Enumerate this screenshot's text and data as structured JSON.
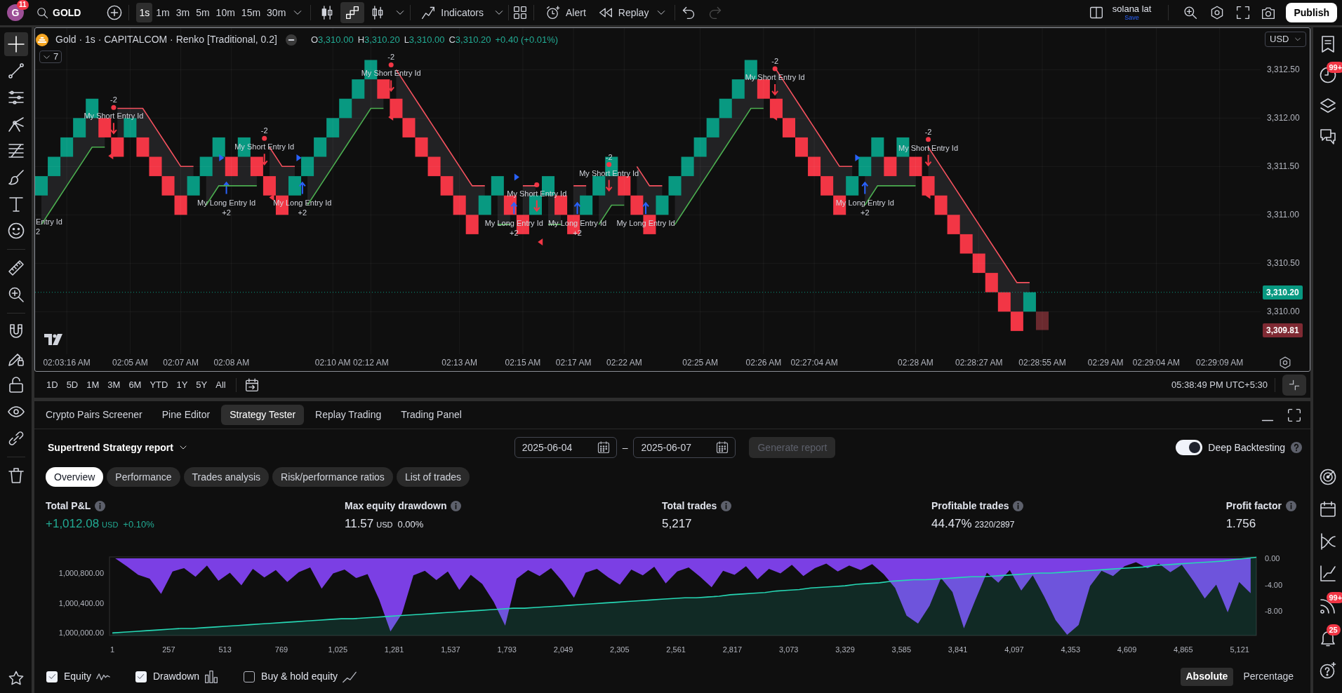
{
  "header": {
    "avatar": {
      "letter": "G",
      "badge": "11"
    },
    "symbol": "GOLD",
    "timeframes": [
      {
        "label": "1s",
        "selected": true
      },
      {
        "label": "1m",
        "selected": false
      },
      {
        "label": "3m",
        "selected": false
      },
      {
        "label": "5m",
        "selected": false
      },
      {
        "label": "10m",
        "selected": false
      },
      {
        "label": "15m",
        "selected": false
      },
      {
        "label": "30m",
        "selected": false
      }
    ],
    "chart_types": [
      {
        "kind": "candles",
        "selected": false
      },
      {
        "kind": "renko",
        "selected": true
      },
      {
        "kind": "hollow",
        "selected": false
      }
    ],
    "indicators": "Indicators",
    "alert": "Alert",
    "replay": "Replay",
    "undo": {
      "disabled": false
    },
    "redo": {
      "disabled": true
    },
    "layout": {
      "name": "solana lat",
      "status": "Save"
    },
    "publish": "Publish"
  },
  "left_toolbar": {
    "groups": [
      {
        "tools": [
          {
            "kind": "crosshair",
            "selected": true
          },
          {
            "kind": "trend_line",
            "selected": false
          },
          {
            "kind": "hlines",
            "selected": false
          },
          {
            "kind": "pitchfork",
            "selected": false
          },
          {
            "kind": "fib",
            "selected": false
          },
          {
            "kind": "brush",
            "selected": false
          },
          {
            "kind": "text",
            "selected": false
          },
          {
            "kind": "emoji",
            "selected": false
          }
        ]
      },
      {
        "tools": [
          {
            "kind": "ruler",
            "selected": false
          },
          {
            "kind": "zoom_in",
            "selected": false
          }
        ]
      },
      {
        "tools": [
          {
            "kind": "magnet",
            "selected": false
          },
          {
            "kind": "lock_draw",
            "selected": false
          },
          {
            "kind": "lock",
            "selected": false
          },
          {
            "kind": "eye",
            "selected": false
          },
          {
            "kind": "link",
            "selected": false
          }
        ]
      },
      {
        "tools": [
          {
            "kind": "trash",
            "selected": false
          }
        ]
      }
    ]
  },
  "chart": {
    "ohlc": [
      {
        "key": "O",
        "value": "3,310.00"
      },
      {
        "key": "H",
        "value": "3,310.20"
      },
      {
        "key": "L",
        "value": "3,310.00"
      },
      {
        "key": "C",
        "value": "3,310.20"
      }
    ],
    "change": "+0.40 (+0.01%)",
    "indicators_count": "7",
    "currency": "USD",
    "bricks": [
      {
        "kind": "up"
      },
      {
        "kind": "up"
      },
      {
        "kind": "up"
      },
      {
        "kind": "up"
      },
      {
        "kind": "up"
      },
      {
        "kind": "down"
      },
      {
        "kind": "down"
      },
      {
        "kind": "up"
      },
      {
        "kind": "down"
      },
      {
        "kind": "down"
      },
      {
        "kind": "down"
      },
      {
        "kind": "down"
      },
      {
        "kind": "up"
      },
      {
        "kind": "up"
      },
      {
        "kind": "up"
      },
      {
        "kind": "down"
      },
      {
        "kind": "up"
      },
      {
        "kind": "down"
      },
      {
        "kind": "down"
      },
      {
        "kind": "down"
      },
      {
        "kind": "up"
      },
      {
        "kind": "up"
      },
      {
        "kind": "up"
      },
      {
        "kind": "up"
      },
      {
        "kind": "up"
      },
      {
        "kind": "up"
      },
      {
        "kind": "up"
      },
      {
        "kind": "down"
      },
      {
        "kind": "down"
      },
      {
        "kind": "down"
      },
      {
        "kind": "down"
      },
      {
        "kind": "down"
      },
      {
        "kind": "down"
      },
      {
        "kind": "down"
      },
      {
        "kind": "down"
      },
      {
        "kind": "up"
      },
      {
        "kind": "up"
      },
      {
        "kind": "down"
      },
      {
        "kind": "down"
      },
      {
        "kind": "up"
      },
      {
        "kind": "up"
      },
      {
        "kind": "down"
      },
      {
        "kind": "down"
      },
      {
        "kind": "up"
      },
      {
        "kind": "up"
      },
      {
        "kind": "up"
      },
      {
        "kind": "down"
      },
      {
        "kind": "down"
      },
      {
        "kind": "down"
      },
      {
        "kind": "up"
      },
      {
        "kind": "up"
      },
      {
        "kind": "up"
      },
      {
        "kind": "up"
      },
      {
        "kind": "up"
      },
      {
        "kind": "up"
      },
      {
        "kind": "up"
      },
      {
        "kind": "up"
      },
      {
        "kind": "down"
      },
      {
        "kind": "down"
      },
      {
        "kind": "down"
      },
      {
        "kind": "down"
      },
      {
        "kind": "down"
      },
      {
        "kind": "down"
      },
      {
        "kind": "down"
      },
      {
        "kind": "up"
      },
      {
        "kind": "up"
      },
      {
        "kind": "up"
      },
      {
        "kind": "down"
      },
      {
        "kind": "up"
      },
      {
        "kind": "down"
      },
      {
        "kind": "down"
      },
      {
        "kind": "down"
      },
      {
        "kind": "down"
      },
      {
        "kind": "down"
      },
      {
        "kind": "down"
      },
      {
        "kind": "down"
      },
      {
        "kind": "down"
      },
      {
        "kind": "down"
      },
      {
        "kind": "up"
      },
      {
        "kind": "pending"
      }
    ],
    "signals": [
      {
        "kind": "long",
        "label": "Entry Id",
        "qty": "2"
      },
      {
        "kind": "short",
        "label": "My Short Entry Id",
        "qty": "-2"
      },
      {
        "kind": "long",
        "label": "My Long Entry Id",
        "qty": "+2"
      },
      {
        "kind": "short",
        "label": "My Short Entry Id",
        "qty": "-2"
      },
      {
        "kind": "long",
        "label": "My Long Entry Id",
        "qty": "+2"
      },
      {
        "kind": "short",
        "label": "My Short Entry Id",
        "qty": "-2"
      },
      {
        "kind": "long",
        "label": "My Long Entry Id",
        "qty": "+2"
      },
      {
        "kind": "short",
        "label": "My Short Entry Id"
      },
      {
        "kind": "long",
        "label": "My Long Entry Id",
        "qty": "+2"
      },
      {
        "kind": "short",
        "label": "My Short Entry Id",
        "qty": "-2"
      },
      {
        "kind": "long",
        "label": "My Long Entry Id"
      },
      {
        "kind": "short",
        "label": "My Short Entry Id",
        "qty": "-2"
      },
      {
        "kind": "long",
        "label": "My Long Entry Id",
        "qty": "+2"
      },
      {
        "kind": "short",
        "label": "My Short Entry Id",
        "qty": "-2"
      }
    ],
    "markers": [
      {
        "kind": "short"
      },
      {
        "kind": "long"
      },
      {
        "kind": "short"
      },
      {
        "kind": "long"
      },
      {
        "kind": "short"
      },
      {
        "kind": "long"
      },
      {
        "kind": "short"
      },
      {
        "kind": "short"
      },
      {
        "kind": "long"
      },
      {
        "kind": "short"
      }
    ],
    "price_tags": [
      {
        "label": "3,310.20",
        "color": "#089981"
      },
      {
        "label": "3,309.81",
        "color": "#7f2a33"
      }
    ],
    "chart_data": {
      "type": "line",
      "title": "Gold · 1s · CAPITALCOM · Renko [Traditional, 0.2]",
      "categories": [
        null,
        null,
        "02:03:16 AM",
        null,
        null,
        null,
        null,
        "02:05 AM",
        null,
        null,
        null,
        "02:07 AM",
        null,
        null,
        null,
        "02:08 AM",
        null,
        null,
        null,
        null,
        null,
        null,
        null,
        "02:10 AM",
        null,
        null,
        "02:12 AM",
        null,
        null,
        null,
        null,
        null,
        null,
        "02:13 AM",
        null,
        null,
        null,
        null,
        "02:15 AM",
        null,
        null,
        null,
        "02:17 AM",
        null,
        null,
        null,
        "02:22 AM",
        null,
        null,
        null,
        null,
        null,
        "02:25 AM",
        null,
        null,
        null,
        null,
        "02:26 AM",
        null,
        null,
        null,
        "02:27:04 AM",
        null,
        null,
        null,
        null,
        null,
        null,
        null,
        "02:28 AM",
        null,
        null,
        null,
        null,
        "02:28:27 AM",
        null,
        null,
        null,
        null,
        "02:28:55 AM",
        null,
        null,
        null,
        null,
        "02:29 AM",
        null,
        null,
        null,
        "02:29:04 AM",
        null,
        null,
        null,
        null,
        "02:29:09 AM"
      ],
      "series": [
        {
          "color": "#4caf50",
          "values": [
            3310.9,
            3311.1,
            3311.3,
            3311.5,
            3311.7,
            3311.7,
            null,
            null,
            null,
            null,
            null,
            null,
            null,
            3311.1,
            3311.3,
            3311.3,
            3311.3,
            3311.3,
            null,
            null,
            null,
            3311.1,
            3311.3,
            3311.5,
            3311.7,
            3311.9,
            3312.1,
            3312.1,
            null,
            null,
            null,
            null,
            null,
            null,
            null,
            null,
            3310.9,
            3310.9,
            null,
            null,
            3310.9,
            3310.9,
            null,
            null,
            3310.9,
            3311.1,
            3311.1,
            null,
            null,
            null,
            3310.9,
            3311.1,
            3311.3,
            3311.5,
            3311.7,
            3311.9,
            3312.1,
            3312.1,
            null,
            null,
            null,
            null,
            null,
            null,
            null,
            3311.1,
            3311.3,
            3311.3,
            3311.3,
            3311.3,
            null,
            null,
            null,
            null,
            null,
            null,
            null,
            null,
            null,
            null,
            null,
            null,
            null,
            null,
            null,
            null,
            null,
            null,
            null,
            null,
            null,
            null,
            null,
            null
          ]
        },
        {
          "color": "#f7525f",
          "values": [
            null,
            null,
            null,
            null,
            null,
            null,
            3312.1,
            3312.1,
            3312.1,
            3311.9,
            3311.7,
            3311.5,
            3311.5,
            null,
            null,
            null,
            null,
            null,
            3311.7,
            3311.5,
            3311.5,
            null,
            null,
            null,
            null,
            null,
            null,
            null,
            3312.5,
            3312.3,
            3312.1,
            3311.9,
            3311.7,
            3311.5,
            3311.3,
            3311.3,
            null,
            null,
            3311.3,
            3311.3,
            null,
            null,
            3311.3,
            3311.3,
            null,
            null,
            null,
            3311.5,
            3311.3,
            3311.3,
            null,
            null,
            null,
            null,
            null,
            null,
            null,
            null,
            3312.5,
            3312.3,
            3312.1,
            3311.9,
            3311.7,
            3311.5,
            3311.5,
            null,
            null,
            null,
            null,
            null,
            3311.7,
            3311.5,
            3311.3,
            3311.1,
            3310.9,
            3310.7,
            3310.5,
            3310.3,
            3310.3,
            null,
            null,
            null,
            null,
            null,
            null,
            null,
            null,
            null,
            null,
            null,
            null,
            null,
            null,
            null
          ]
        }
      ],
      "ylim": [
        3309.56,
        3312.93
      ],
      "yticks": [
        {
          "value": 3310,
          "label": "3,310.00"
        },
        {
          "value": 3310.5,
          "label": "3,310.50"
        },
        {
          "value": 3311,
          "label": "3,311.00"
        },
        {
          "value": 3311.5,
          "label": "3,311.50"
        },
        {
          "value": 3312,
          "label": "3,312.00"
        },
        {
          "value": 3312.5,
          "label": "3,312.50"
        }
      ],
      "grid": true
    }
  },
  "chart_footer": {
    "ranges": [
      "1D",
      "5D",
      "1M",
      "3M",
      "6M",
      "YTD",
      "1Y",
      "5Y",
      "All"
    ],
    "clock": "05:38:49 PM UTC+5:30"
  },
  "right_toolbar": {
    "top": [
      {
        "kind": "watchlist"
      },
      {
        "kind": "alert_clock",
        "badge": "99+"
      },
      {
        "kind": "layers"
      },
      {
        "kind": "chat"
      }
    ],
    "bottom": [
      {
        "kind": "target"
      },
      {
        "kind": "calendar"
      },
      {
        "kind": "ideas"
      },
      {
        "kind": "chart_line"
      },
      {
        "kind": "feed",
        "badge": "99+"
      },
      {
        "kind": "bell",
        "badge": "25"
      },
      {
        "kind": "help"
      }
    ]
  },
  "panel": {
    "tabs": [
      {
        "label": "Crypto Pairs Screener",
        "selected": false
      },
      {
        "label": "Pine Editor",
        "selected": false
      },
      {
        "label": "Strategy Tester",
        "selected": true
      },
      {
        "label": "Replay Trading",
        "selected": false
      },
      {
        "label": "Trading Panel",
        "selected": false
      }
    ],
    "report": {
      "title": "Supertrend Strategy report",
      "date_from": "2025-06-04",
      "date_separator": "–",
      "date_to": "2025-06-07",
      "generate": {
        "label": "Generate report",
        "disabled": true
      },
      "deep_backtesting": {
        "label": "Deep Backtesting",
        "on": true
      }
    },
    "views": [
      {
        "label": "Overview",
        "selected": true
      },
      {
        "label": "Performance",
        "selected": false
      },
      {
        "label": "Trades analysis",
        "selected": false
      },
      {
        "label": "Risk/performance ratios",
        "selected": false
      },
      {
        "label": "List of trades",
        "selected": false
      }
    ],
    "stats": [
      {
        "label": "Total P&L",
        "value": "+1,012.08",
        "unit": "USD",
        "change": "+0.10%",
        "positive": true
      },
      {
        "label": "Max equity drawdown",
        "value": "11.57",
        "unit": "USD",
        "change": "0.00%",
        "positive": false
      },
      {
        "label": "Total trades",
        "value": "5,217",
        "positive": false
      },
      {
        "label": "Profitable trades",
        "value": "44.47%",
        "detail": "2320/2897",
        "positive": false
      },
      {
        "label": "Profit factor",
        "value": "1.756",
        "positive": false
      }
    ],
    "equity_chart": {
      "chart_data": {
        "type": "area",
        "x": [
          1,
          53,
          105,
          157,
          209,
          261,
          313,
          365,
          417,
          469,
          521,
          573,
          625,
          677,
          729,
          781,
          833,
          885,
          937,
          989,
          1041,
          1093,
          1145,
          1197,
          1249,
          1301,
          1353,
          1405,
          1457,
          1509,
          1561,
          1613,
          1665,
          1717,
          1769,
          1821,
          1873,
          1925,
          1977,
          2029,
          2081,
          2133,
          2185,
          2237,
          2289,
          2341,
          2393,
          2445,
          2497,
          2549,
          2601,
          2653,
          2705,
          2757,
          2809,
          2861,
          2913,
          2965,
          3017,
          3069,
          3121,
          3173,
          3225,
          3277,
          3329,
          3381,
          3433,
          3485,
          3537,
          3589,
          3641,
          3693,
          3745,
          3797,
          3849,
          3901,
          3953,
          4005,
          4057,
          4109,
          4161,
          4213,
          4265,
          4317,
          4369,
          4421,
          4473,
          4525,
          4577,
          4629,
          4681,
          4733,
          4785,
          4837,
          4889,
          4941,
          4993,
          5045,
          5097,
          5197
        ],
        "series": [
          {
            "color": "#26d7b4",
            "values": [
              1000000,
              1000010,
              1000020,
              1000030,
              1000040,
              1000050,
              1000060,
              1000060,
              1000070,
              1000080,
              1000090,
              1000100,
              1000110,
              1000120,
              1000130,
              1000140,
              1000150,
              1000160,
              1000170,
              1000180,
              1000190,
              1000190,
              1000200,
              1000210,
              1000220,
              1000230,
              1000240,
              1000250,
              1000260,
              1000270,
              1000280,
              1000290,
              1000300,
              1000310,
              1000320,
              1000330,
              1000330,
              1000340,
              1000350,
              1000360,
              1000370,
              1000380,
              1000390,
              1000400,
              1000410,
              1000420,
              1000430,
              1000440,
              1000450,
              1000460,
              1000470,
              1000470,
              1000480,
              1000490,
              1000510,
              1000520,
              1000530,
              1000540,
              1000560,
              1000570,
              1000580,
              1000600,
              1000610,
              1000620,
              1000630,
              1000650,
              1000660,
              1000670,
              1000690,
              1000700,
              1000710,
              1000710,
              1000720,
              1000730,
              1000740,
              1000750,
              1000750,
              1000760,
              1000770,
              1000780,
              1000790,
              1000800,
              1000800,
              1000810,
              1000820,
              1000830,
              1000840,
              1000850,
              1000860,
              1000870,
              1000880,
              1000900,
              1000910,
              1000920,
              1000930,
              1000940,
              1000950,
              1000960,
              1000980,
              1001010
            ]
          }
        ],
        "xlim": [
          -12,
          5197
        ],
        "ylim": [
          999966,
          1001015
        ],
        "xticks": [
          {
            "value": 1,
            "label": "1"
          },
          {
            "value": 257,
            "label": "257"
          },
          {
            "value": 513,
            "label": "513"
          },
          {
            "value": 769,
            "label": "769"
          },
          {
            "value": 1025,
            "label": "1,025"
          },
          {
            "value": 1281,
            "label": "1,281"
          },
          {
            "value": 1537,
            "label": "1,537"
          },
          {
            "value": 1793,
            "label": "1,793"
          },
          {
            "value": 2049,
            "label": "2,049"
          },
          {
            "value": 2305,
            "label": "2,305"
          },
          {
            "value": 2561,
            "label": "2,561"
          },
          {
            "value": 2817,
            "label": "2,817"
          },
          {
            "value": 3073,
            "label": "3,073"
          },
          {
            "value": 3329,
            "label": "3,329"
          },
          {
            "value": 3585,
            "label": "3,585"
          },
          {
            "value": 3841,
            "label": "3,841"
          },
          {
            "value": 4097,
            "label": "4,097"
          },
          {
            "value": 4353,
            "label": "4,353"
          },
          {
            "value": 4609,
            "label": "4,609"
          },
          {
            "value": 4865,
            "label": "4,865"
          },
          {
            "value": 5121,
            "label": "5,121"
          }
        ],
        "yticks": [
          {
            "value": 1000000,
            "label": "1,000,000.00"
          },
          {
            "value": 1000400,
            "label": "1,000,400.00"
          },
          {
            "value": 1000800,
            "label": "1,000,800.00"
          }
        ]
      }
    },
    "drawdown_chart": {
      "chart_data": {
        "type": "area",
        "categories": [
          null,
          null,
          null,
          null,
          null,
          null,
          null,
          null,
          null,
          null,
          null,
          null,
          null,
          null,
          null,
          null,
          null,
          null,
          null,
          null,
          null,
          null,
          null,
          null,
          null,
          null,
          null,
          null,
          null,
          null,
          null,
          null,
          null,
          null,
          null,
          null,
          null,
          null,
          null,
          null,
          null,
          null,
          null,
          null,
          null,
          null,
          null,
          null,
          null,
          null,
          null,
          null,
          null,
          null,
          null,
          null,
          null,
          null,
          null,
          null,
          null,
          null,
          null,
          null,
          null,
          null,
          null,
          null,
          null,
          null,
          null,
          null,
          null,
          null,
          null,
          null,
          null,
          null,
          null,
          null,
          null,
          null,
          null,
          null,
          null,
          null,
          null,
          null,
          null,
          null,
          null,
          null,
          null,
          null,
          null,
          null,
          null,
          null,
          null,
          null
        ],
        "series": [
          {
            "color": "#7b3fe4",
            "values": [
              0,
              -1.2,
              -2.5,
              -3.1,
              -5.4,
              -2.0,
              -1.5,
              -2.8,
              -1.1,
              -3.4,
              -2.2,
              -4.1,
              -1.6,
              -2.9,
              -1.8,
              -3.6,
              -2.1,
              -1.4,
              -4.6,
              -2.3,
              -1.7,
              -3.0,
              -2.4,
              -6.2,
              -11.1,
              -8.4,
              -2.6,
              -1.9,
              -3.3,
              -2.0,
              -4.8,
              -2.5,
              -3.9,
              -6.6,
              -10.2,
              -3.1,
              -1.8,
              -2.7,
              -1.5,
              -3.5,
              -6.0,
              -2.2,
              -1.6,
              -2.9,
              -4.0,
              -1.7,
              -2.6,
              -1.3,
              -3.8,
              -2.0,
              -1.4,
              -2.8,
              -4.4,
              -1.9,
              -2.5,
              -1.2,
              -3.2,
              -1.6,
              -2.3,
              -1.0,
              -2.7,
              -1.5,
              -0.8,
              -2.0,
              -1.1,
              -1.8,
              -0.9,
              -2.4,
              -4.5,
              -8.7,
              -9.9,
              -7.2,
              -3.0,
              -5.1,
              -10.6,
              -6.3,
              -2.2,
              -3.7,
              -1.8,
              -4.9,
              -2.6,
              -5.8,
              -9.4,
              -11.6,
              -10.1,
              -4.2,
              -1.9,
              -2.7,
              -1.2,
              -0.6,
              -1.5,
              -0.8,
              -2.1,
              -1.0,
              -3.4,
              -6.1,
              -4.0,
              -8.2,
              -3.6,
              -5.3
            ]
          }
        ],
        "ylim": [
          -11.7,
          0.2
        ],
        "yticks": [
          {
            "value": 0,
            "label": "0.00"
          },
          {
            "value": -4,
            "label": "-4.00"
          },
          {
            "value": -8,
            "label": "-8.00"
          }
        ]
      }
    },
    "legend": [
      {
        "label": "Equity",
        "checked": true,
        "kind": "wave"
      },
      {
        "label": "Drawdown",
        "checked": true,
        "kind": "bars"
      },
      {
        "label": "Buy & hold equity",
        "checked": false,
        "kind": "line"
      }
    ],
    "scale_modes": [
      {
        "label": "Absolute",
        "selected": true
      },
      {
        "label": "Percentage",
        "selected": false
      }
    ]
  }
}
